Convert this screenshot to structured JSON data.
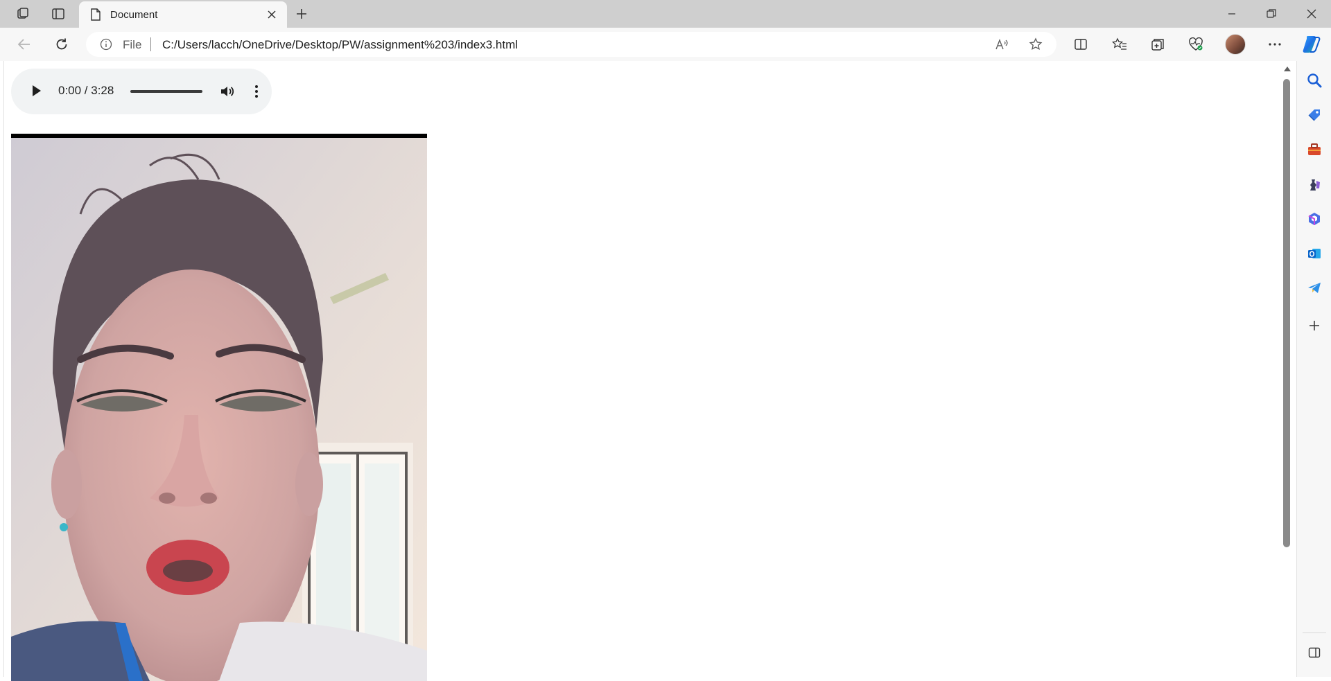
{
  "browser": {
    "tab": {
      "title": "Document"
    },
    "address": {
      "scheme_label": "File",
      "url": "C:/Users/lacch/OneDrive/Desktop/PW/assignment%203/index3.html"
    }
  },
  "page": {
    "audio": {
      "time": "0:00 / 3:28"
    },
    "video": {
      "icon": "video-frame"
    }
  },
  "sidebar": {
    "icons": [
      "search-icon",
      "shopping-tag-icon",
      "toolbox-icon",
      "games-icon",
      "microsoft365-icon",
      "outlook-icon",
      "telegram-icon",
      "add-icon",
      "sidebar-toggle-icon"
    ]
  },
  "colors": {
    "titlebar_bg": "#cfcfcf",
    "toolbar_bg": "#f7f7f7",
    "audio_bg": "#f1f3f4"
  }
}
